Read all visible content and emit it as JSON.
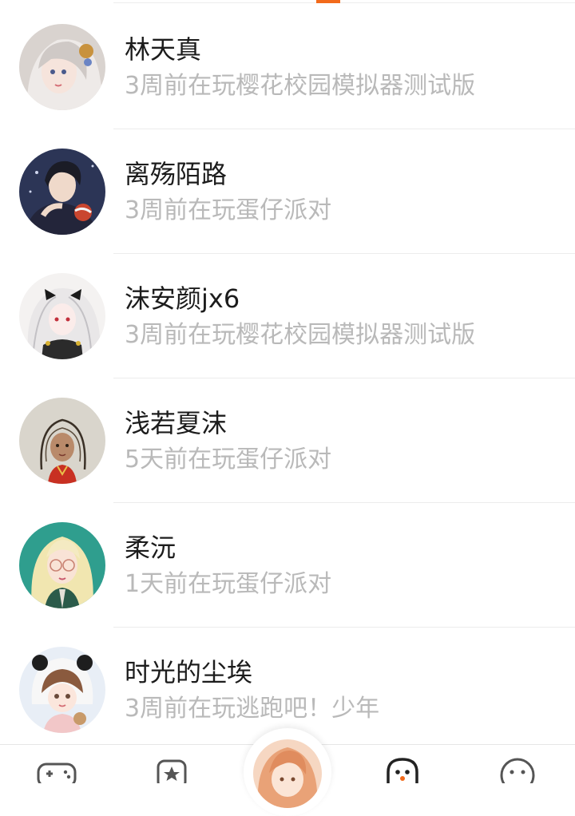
{
  "friends": [
    {
      "name": "林天真",
      "status": "3周前在玩樱花校园模拟器测试版",
      "avatar": "white-haired-girl-avatar"
    },
    {
      "name": "离殇陌路",
      "status": "3周前在玩蛋仔派对",
      "avatar": "dark-haired-boy-avatar"
    },
    {
      "name": "沫安颜jx6",
      "status": "3周前在玩樱花校园模拟器测试版",
      "avatar": "white-haired-bow-girl-avatar"
    },
    {
      "name": "浅若夏沫",
      "status": "5天前在玩蛋仔派对",
      "avatar": "sketch-girl-avatar"
    },
    {
      "name": "柔沅",
      "status": "1天前在玩蛋仔派对",
      "avatar": "blonde-glasses-girl-avatar"
    },
    {
      "name": "时光的尘埃",
      "status": "3周前在玩逃跑吧！少年",
      "avatar": "panda-hood-girl-avatar"
    }
  ],
  "tabbar": {
    "tabs": [
      {
        "icon": "gamepad-icon"
      },
      {
        "icon": "star-icon"
      },
      {
        "icon": "profile-avatar"
      },
      {
        "icon": "ghost-icon"
      },
      {
        "icon": "chat-icon"
      }
    ]
  },
  "colors": {
    "accent": "#f26a1b",
    "name_text": "#1c1c1c",
    "status_text": "#b9b9b9",
    "divider": "#ececec"
  }
}
